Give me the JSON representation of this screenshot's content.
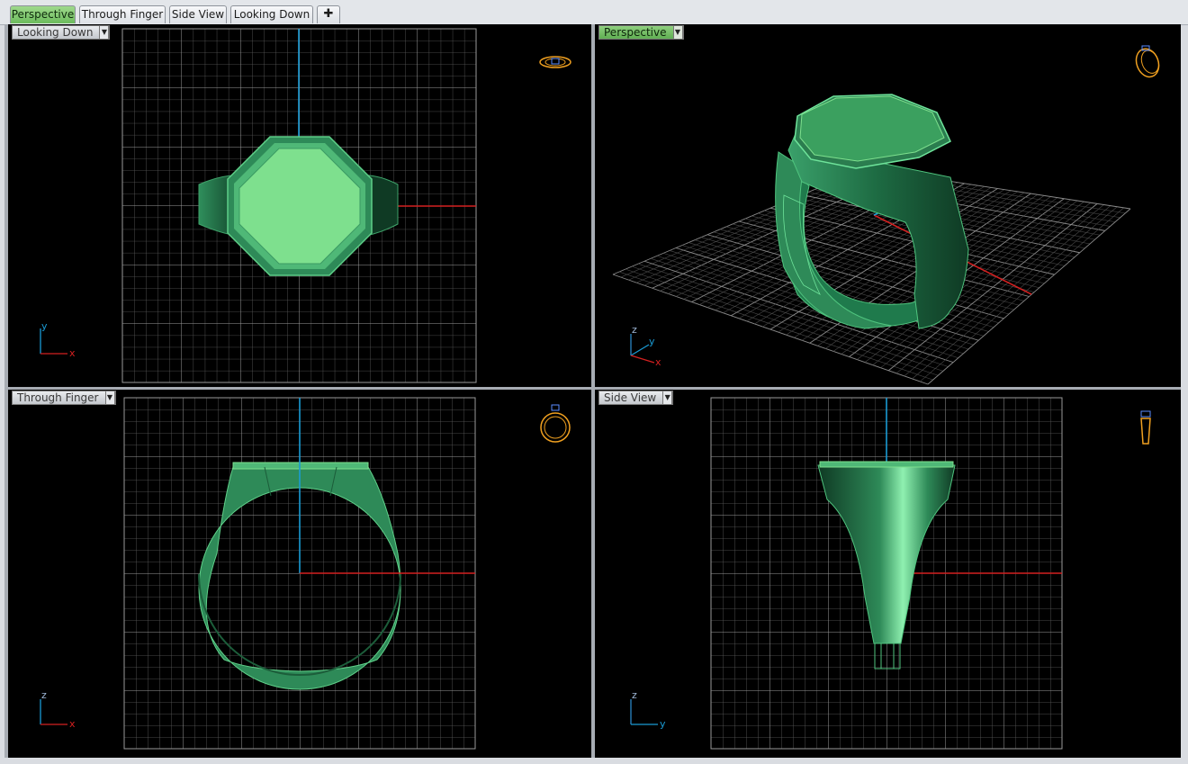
{
  "tabs": [
    {
      "label": "Perspective",
      "active": true
    },
    {
      "label": "Through Finger",
      "active": false
    },
    {
      "label": "Side View",
      "active": false
    },
    {
      "label": "Looking Down",
      "active": false
    }
  ],
  "add_tab_icon": "plus-icon",
  "viewports": {
    "top_left": {
      "label": "Looking Down",
      "axes": [
        "y",
        "x"
      ]
    },
    "top_right": {
      "label": "Perspective",
      "axes": [
        "z",
        "y",
        "x"
      ]
    },
    "bottom_left": {
      "label": "Through Finger",
      "axes": [
        "z",
        "x"
      ]
    },
    "bottom_right": {
      "label": "Side View",
      "axes": [
        "z",
        "y"
      ]
    }
  },
  "colors": {
    "viewport_bg": "#000000",
    "grid": "#8a8a8a",
    "x_axis": "#d42020",
    "y_axis": "#1a9bd4",
    "model_green": "#2e8a58",
    "model_light": "#7ee08e",
    "active_tab": "#6cbb5d",
    "nav_widget": "#f0a020"
  }
}
